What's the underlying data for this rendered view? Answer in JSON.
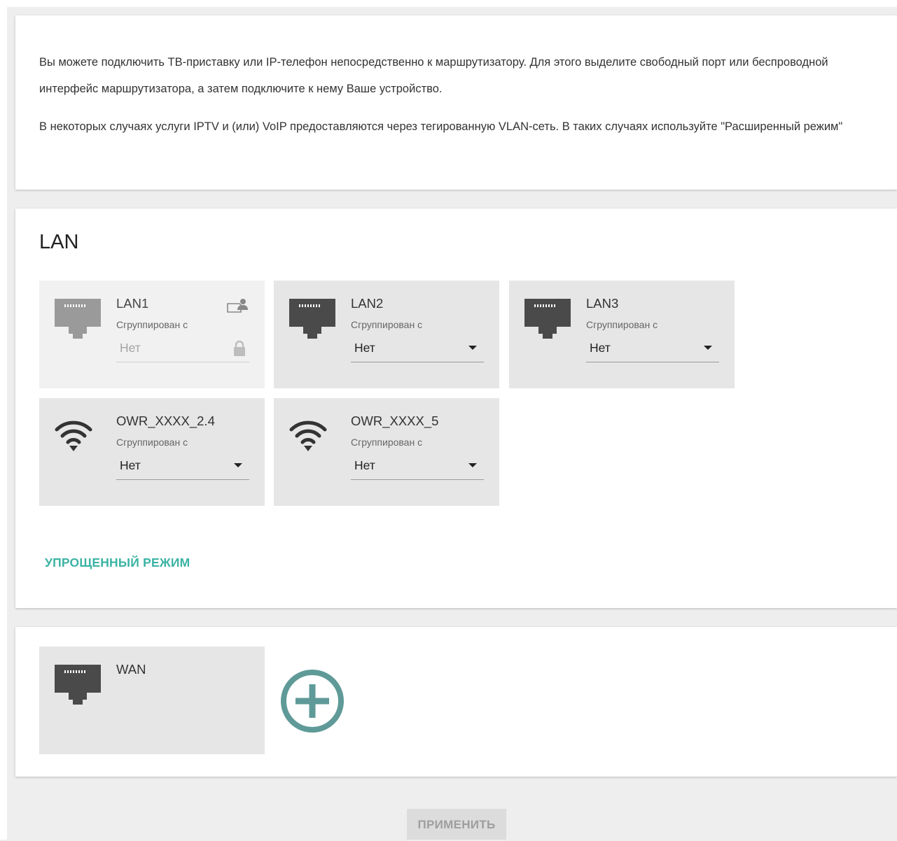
{
  "info": {
    "paragraph1": "Вы можете подключить ТВ-приставку или IP-телефон непосредственно к маршрутизатору. Для этого выделите свободный порт или беспроводной интерфейс маршрутизатора, а затем подключите к нему Ваше устройство.",
    "paragraph2": "В некоторых случаях услуги IPTV и (или) VoIP предоставляются через тегированную VLAN-сеть. В таких случаях используйте \"Расширенный режим\""
  },
  "lan": {
    "title": "LAN",
    "ports": [
      {
        "name": "LAN1",
        "sub": "Сгруппирован с",
        "value": "Нет",
        "type": "ethernet",
        "locked": true
      },
      {
        "name": "LAN2",
        "sub": "Сгруппирован с",
        "value": "Нет",
        "type": "ethernet",
        "locked": false
      },
      {
        "name": "LAN3",
        "sub": "Сгруппирован с",
        "value": "Нет",
        "type": "ethernet",
        "locked": false
      },
      {
        "name": "OWR_XXXX_2.4",
        "sub": "Сгруппирован с",
        "value": "Нет",
        "type": "wifi",
        "locked": false
      },
      {
        "name": "OWR_XXXX_5",
        "sub": "Сгруппирован с",
        "value": "Нет",
        "type": "wifi",
        "locked": false
      }
    ],
    "simple_mode_label": "УПРОЩЕННЫЙ РЕЖИМ"
  },
  "wan": {
    "ports": [
      {
        "name": "WAN",
        "type": "ethernet"
      }
    ],
    "add_icon": "plus-circle-icon"
  },
  "actions": {
    "apply_label": "ПРИМЕНИТЬ"
  },
  "colors": {
    "accent": "#3bb3a4",
    "add_button": "#5f9a98",
    "port_icon": "#4a4a4a",
    "port_icon_disabled": "#9a9a9a",
    "tile_background": "#e6e6e6"
  }
}
